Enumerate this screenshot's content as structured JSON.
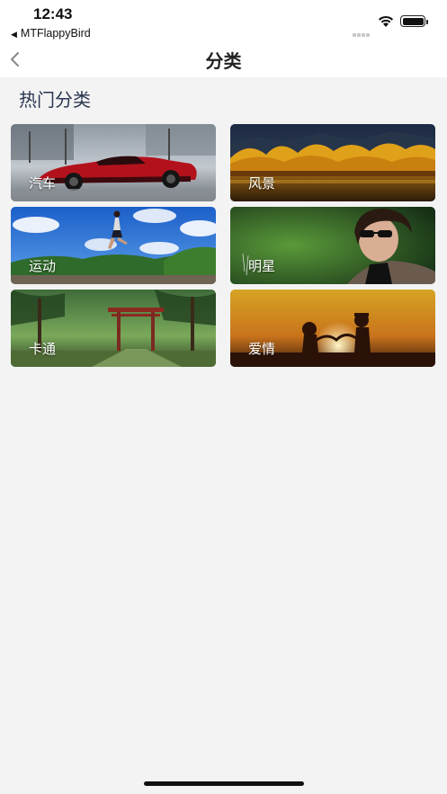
{
  "status_bar": {
    "time": "12:43",
    "back_app": "MTFlappyBird"
  },
  "nav": {
    "title": "分类"
  },
  "section": {
    "title": "热门分类"
  },
  "categories": [
    {
      "label": "汽车"
    },
    {
      "label": "风景"
    },
    {
      "label": "运动"
    },
    {
      "label": "明星"
    },
    {
      "label": "卡通"
    },
    {
      "label": "爱情"
    }
  ]
}
